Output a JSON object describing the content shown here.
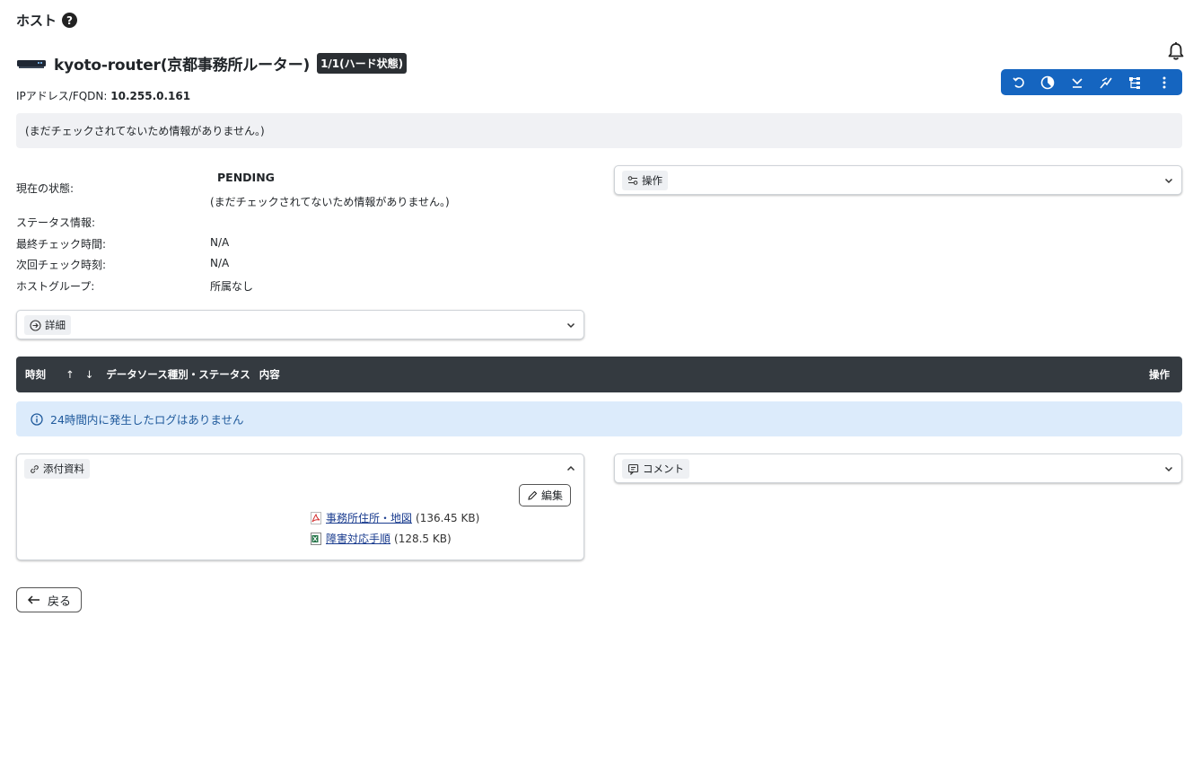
{
  "page": {
    "title": "ホスト",
    "help_symbol": "?"
  },
  "host": {
    "name": "kyoto-router(京都事務所ルーター)",
    "state_badge": "1/1(ハード状態)",
    "ip_label": "IPアドレス/FQDN:",
    "ip_value": "10.255.0.161"
  },
  "toolbar": {
    "buttons": [
      "reschedule-icon",
      "pie-chart-icon",
      "acknowledge-icon",
      "graph-icon",
      "topology-icon",
      "more-vertical-icon"
    ]
  },
  "info_message": "(まだチェックされてないため情報がありません。)",
  "status": {
    "current_label": "現在の状態:",
    "current_value": "PENDING",
    "current_note": "(まだチェックされてないため情報がありません。)",
    "status_info_label": "ステータス情報:",
    "last_check_label": "最終チェック時間:",
    "last_check_value": "N/A",
    "next_check_label": "次回チェック時刻:",
    "next_check_value": "N/A",
    "hostgroup_label": "ホストグループ:",
    "hostgroup_value": "所属なし"
  },
  "panels": {
    "operations_label": "操作",
    "details_label": "詳細",
    "attachments_label": "添付資料",
    "comments_label": "コメント"
  },
  "log_table": {
    "col_time": "時刻",
    "sort_up": "↑",
    "sort_down": "↓",
    "col_source": "データソース種別・ステータス",
    "col_content": "内容",
    "col_ops": "操作",
    "empty_message": "24時間内に発生したログはありません"
  },
  "attachments": {
    "edit_label": "編集",
    "files": [
      {
        "name": "事務所住所・地図",
        "size": "(136.45 KB)",
        "type": "pdf-file-icon"
      },
      {
        "name": "障害対応手順",
        "size": "(128.5 KB)",
        "type": "excel-file-icon"
      }
    ]
  },
  "back_label": "戻る",
  "colors": {
    "toolbar_bg": "#1565c0",
    "log_header_bg": "#343a40",
    "alert_bg": "#dcebfb",
    "link": "#1a3c8f"
  }
}
